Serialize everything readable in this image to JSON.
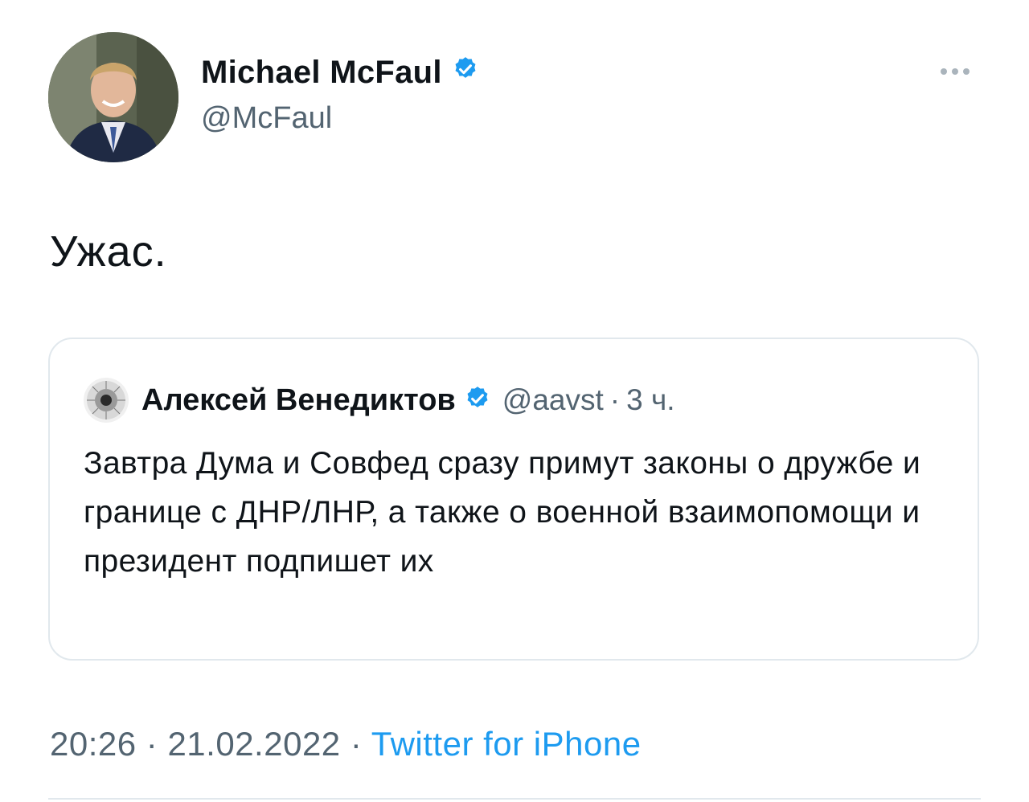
{
  "tweet": {
    "author": {
      "name": "Michael McFaul",
      "handle": "@McFaul",
      "verified_icon": "verified-badge-icon"
    },
    "text": "Ужас.",
    "timestamp": "20:26",
    "date": "21.02.2022",
    "source": "Twitter for iPhone",
    "separator": "·"
  },
  "quoted_tweet": {
    "name": "Алексей Венедиктов",
    "handle": "@aavst",
    "separator": "·",
    "time": "3 ч.",
    "text": "Завтра Дума и Совфед сразу примут законы о дружбе и границе с ДНР/ЛНР, а также о военной взаимопомощи и президент подпишет их"
  },
  "colors": {
    "accent": "#1d9bf0",
    "secondary_text": "#536471",
    "border": "#e1e8ed"
  }
}
